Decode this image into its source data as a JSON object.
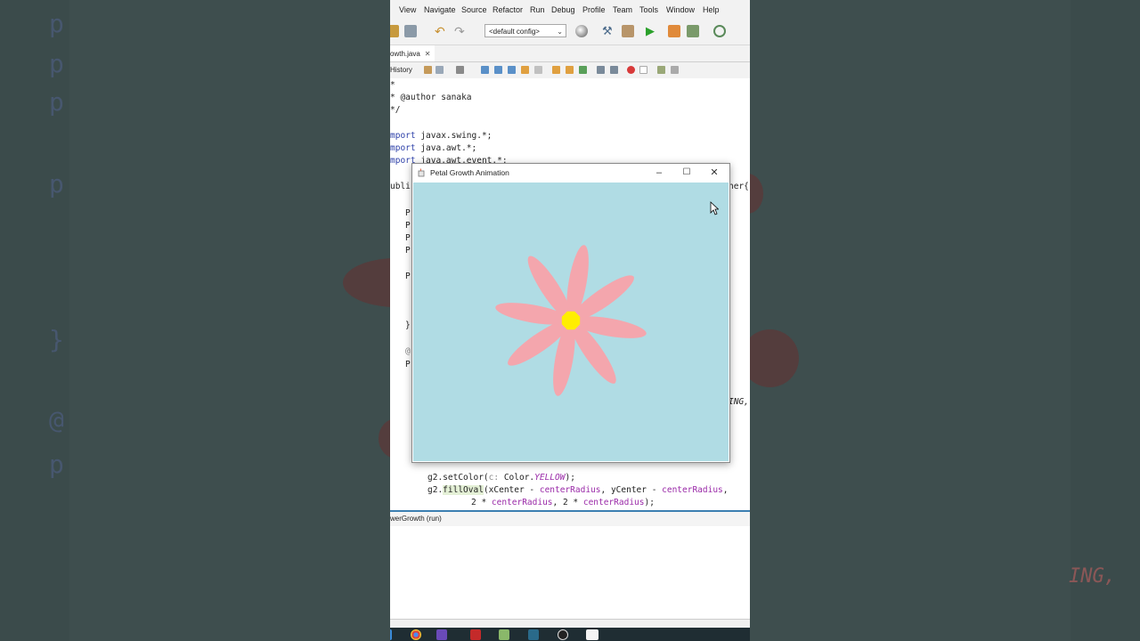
{
  "background": {
    "left_letters": [
      "p",
      "p",
      "p",
      "p",
      "}",
      "@",
      "p"
    ],
    "right_text": "ING,"
  },
  "ide": {
    "menu": [
      "View",
      "Navigate",
      "Source",
      "Refactor",
      "Run",
      "Debug",
      "Profile",
      "Team",
      "Tools",
      "Window",
      "Help"
    ],
    "config_value": "<default config>",
    "tab_label": "owth.java",
    "history_label": "History",
    "code_lines": {
      "l1": "*",
      "l2": "* @author sanaka",
      "l3": "*/",
      "l4_kw": "mport",
      "l4_rest": " javax.swing.*;",
      "l5_kw": "mport",
      "l5_rest": " java.awt.*;",
      "l6_kw": "mport",
      "l6_rest": " java.awt.event.*;",
      "l7_kw": "ubli",
      "l7_right": "ner{",
      "p": "P",
      "brace": "}",
      "at": "@",
      "ing_tail": "ING,",
      "l_setcolor_a": "g2.setColor(",
      "l_setcolor_hint": "c:",
      "l_setcolor_b": " Color.",
      "l_setcolor_c": "YELLOW",
      "l_setcolor_d": ");",
      "l_filloval_a": "g2.",
      "l_filloval_b": "fillOval",
      "l_filloval_c": "(xCenter - ",
      "l_filloval_d": "centerRadius",
      "l_filloval_e": ", yCenter - ",
      "l_filloval_f": "centerRadius",
      "l_filloval_g": ",",
      "l_last_a": "2 * ",
      "l_last_b": "centerRadius",
      "l_last_c": ", 2 * ",
      "l_last_d": "centerRadius",
      "l_last_e": ");"
    },
    "output_tab": "werGrowth (run)"
  },
  "swing_window": {
    "title": "Petal Growth Animation",
    "minimize": "–",
    "maximize": "☐",
    "close": "✕",
    "canvas_color": "#b0dce4",
    "petal_color": "#f4a6ad",
    "center_color": "#ffee00",
    "petal_count": 8
  }
}
